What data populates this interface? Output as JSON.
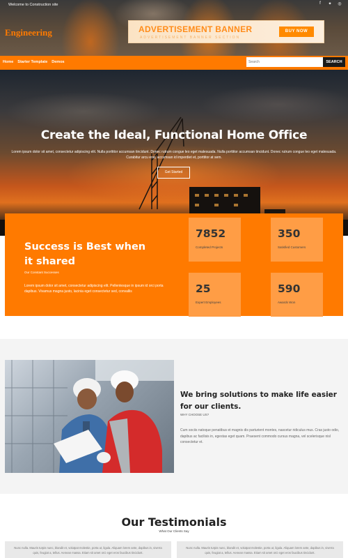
{
  "topbar": {
    "welcome": "Welcome to Construction site",
    "socials": [
      "facebook-icon",
      "twitter-icon",
      "instagram-icon"
    ]
  },
  "brand": {
    "logo": "Engineering",
    "accent": "#ff7a00"
  },
  "ad": {
    "title": "ADVERTISEMENT BANNER",
    "subtitle": "ADVERTISEMENT BANNER SECTION",
    "button": "BUY NOW"
  },
  "nav": {
    "items": [
      "Home",
      "Starter Template",
      "Demos"
    ],
    "search_placeholder": "Search",
    "search_button": "SEARCH"
  },
  "hero": {
    "title": "Create the Ideal, Functional Home Office",
    "text": "Lorem ipsum dolor sit amet, consectetur adipiscing elit. Nulla porttitor accumsan tincidunt. Donec rutrum congue leo eget malesuada. Nulla porttitor accumsan tincidunt. Donec rutrum congue leo eget malesuada. Curabitur arcu erat, accumsan id imperdiet et, porttitor at sem.",
    "button": "Get Started"
  },
  "stats": {
    "title": "Success is Best when it shared",
    "subtitle": "Our Constant Successes",
    "text": "Lorem ipsum dolor sit amet, consectetur adipiscing elit. Pellentesque in ipsum id orci porta dapibus. Vivamus magna justo, lacinia eget consectetur sed, convallis",
    "items": [
      {
        "value": "7852",
        "label": "Completed Projects"
      },
      {
        "value": "350",
        "label": "Satisfied Customers"
      },
      {
        "value": "25",
        "label": "Expert Employees"
      },
      {
        "value": "590",
        "label": "Awards Won"
      }
    ]
  },
  "solutions": {
    "title": "We bring solutions to make life easier for our clients.",
    "subtitle": "WHY CHOOSE US?",
    "text": "Cum sociis natoque penatibus et magnis dis parturient montes, nascetur ridiculus mus. Cras justo odio, dapibus ac facilisis in, egestas eget quam. Praesent commodo cursus magna, vel scelerisque nisl consectetur et."
  },
  "testimonials": {
    "title": "Our Testimonials",
    "subtitle": "What Our Clients Say",
    "cards": [
      "Nunc nulla. Mauris turpis nunc, blandit et, volutpat molestie, porta ut, ligula. Aliquam lorem ante, dapibus in, viverra quis, feugiat a, tellus. Aenean massa. Etiam sit amet orci eget eros faucibus tincidunt.",
      "Nunc nulla. Mauris turpis nunc, blandit et, volutpat molestie, porta ut, ligula. Aliquam lorem ante, dapibus in, viverra quis, feugiat a, tellus. Aenean massa. Etiam sit amet orci eget eros faucibus tincidunt."
    ]
  }
}
